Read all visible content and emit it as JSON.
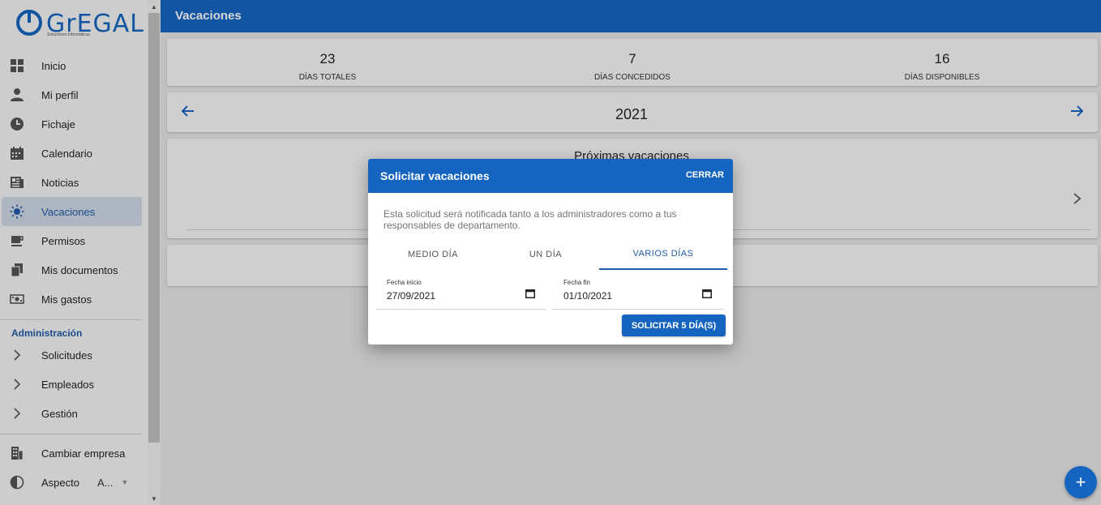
{
  "logo": {
    "word": "GrEGAL",
    "tagline": "Soluciones Informáticas"
  },
  "sidebar": {
    "items": [
      {
        "label": "Inicio"
      },
      {
        "label": "Mi perfil"
      },
      {
        "label": "Fichaje"
      },
      {
        "label": "Calendario"
      },
      {
        "label": "Noticias"
      },
      {
        "label": "Vacaciones",
        "active": true
      },
      {
        "label": "Permisos"
      },
      {
        "label": "Mis documentos"
      },
      {
        "label": "Mis gastos"
      }
    ],
    "admin_title": "Administración",
    "admin_items": [
      {
        "label": "Solicitudes"
      },
      {
        "label": "Empleados"
      },
      {
        "label": "Gestión"
      }
    ],
    "bottom_items": [
      {
        "label": "Cambiar empresa"
      },
      {
        "label": "Aspecto",
        "value": "A..."
      }
    ]
  },
  "header": {
    "title": "Vacaciones"
  },
  "stats": [
    {
      "value": "23",
      "caption": "DÍAS TOTALES"
    },
    {
      "value": "7",
      "caption": "DÍAS CONCEDIDOS"
    },
    {
      "value": "16",
      "caption": "DÍAS DISPONIBLES"
    }
  ],
  "year": "2021",
  "upcoming_title": "Próximas vacaciones",
  "dialog": {
    "title": "Solicitar vacaciones",
    "close_label": "CERRAR",
    "description": "Esta solicitud será notificada tanto a los administradores como a tus responsables de departamento.",
    "tabs": [
      {
        "label": "MEDIO DÍA"
      },
      {
        "label": "UN DÍA"
      },
      {
        "label": "VARIOS DÍAS",
        "active": true
      }
    ],
    "start": {
      "label": "Fecha inicio",
      "value": "27/09/2021"
    },
    "end": {
      "label": "Fecha fin",
      "value": "01/10/2021"
    },
    "submit_label": "SOLICITAR 5 DÍA(S)"
  },
  "fab_symbol": "+",
  "colors": {
    "primary": "#1565c0",
    "active_bg": "#cfd9e6"
  }
}
